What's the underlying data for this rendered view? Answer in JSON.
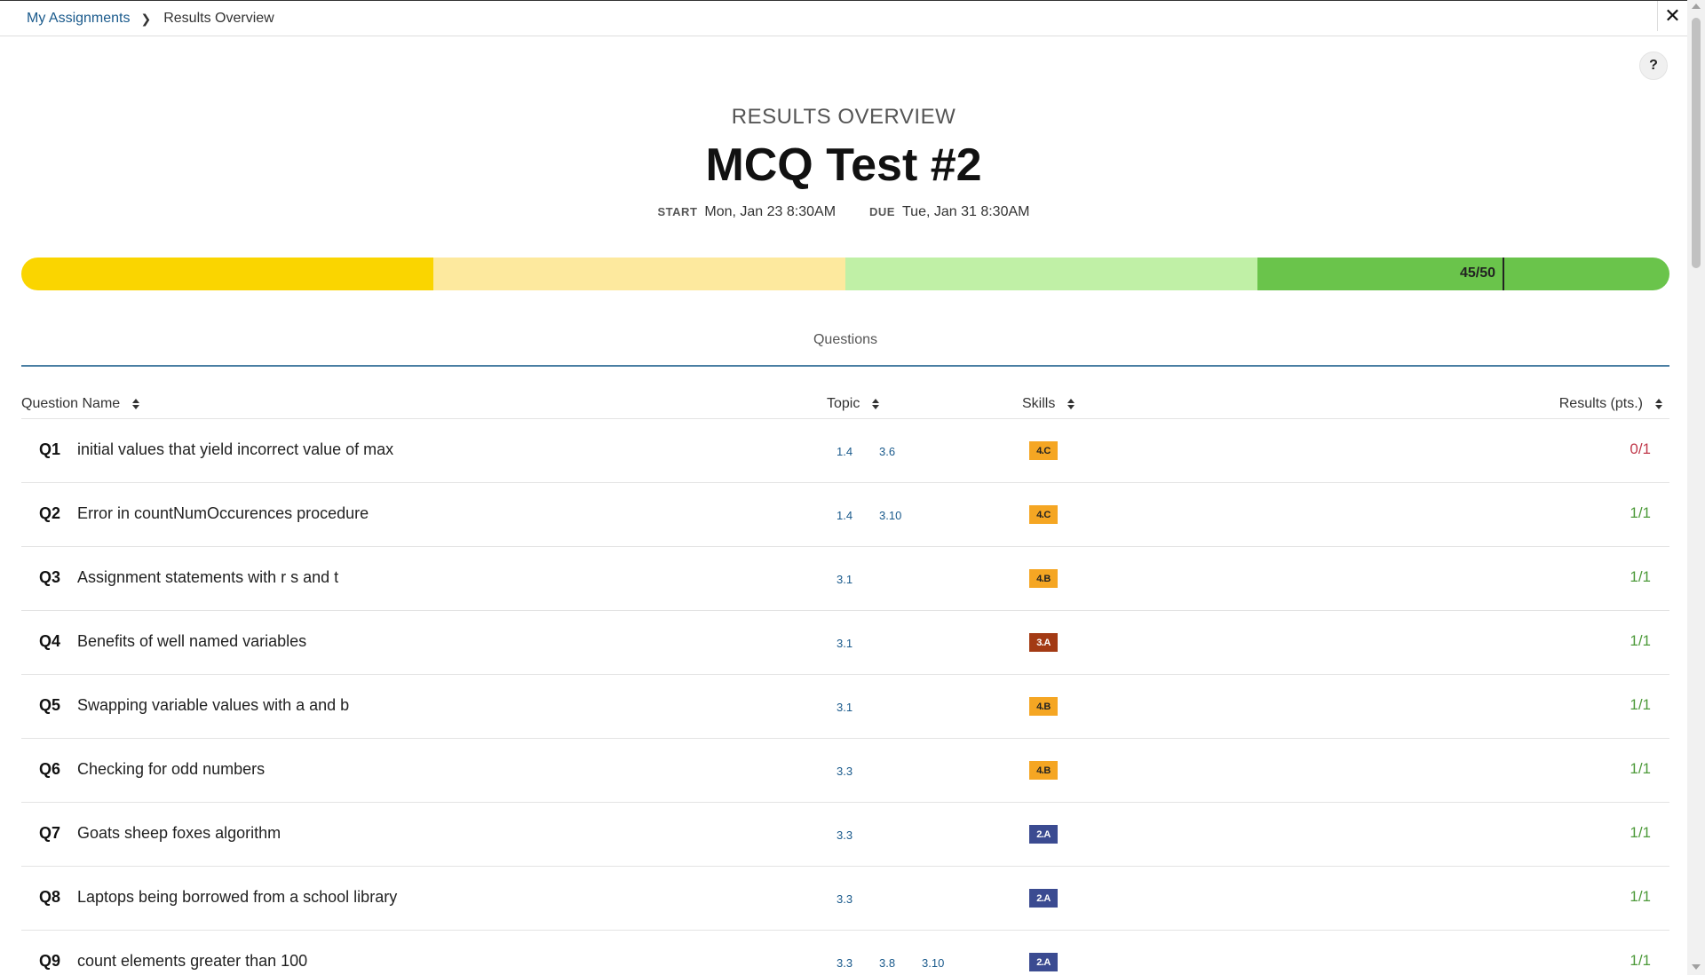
{
  "breadcrumb": {
    "parent": "My Assignments",
    "current": "Results Overview"
  },
  "icons": {
    "close": "close-icon",
    "help": "help-icon",
    "chevron": "chevron-right-icon",
    "sort": "sort-icon"
  },
  "close_glyph": "✕",
  "help_glyph": "?",
  "header": {
    "eyebrow": "RESULTS OVERVIEW",
    "title": "MCQ Test #2",
    "start_label": "START",
    "start_value": "Mon, Jan 23 8:30AM",
    "due_label": "DUE",
    "due_value": "Tue, Jan 31 8:30AM"
  },
  "score": {
    "label": "45/50",
    "earned": 45,
    "total": 50,
    "segment_colors": [
      "#fad500",
      "#fde99e",
      "#c0f0a6",
      "#6ac44b"
    ]
  },
  "tabs": {
    "questions": "Questions"
  },
  "columns": {
    "name": "Question Name",
    "topic": "Topic",
    "skills": "Skills",
    "results": "Results (pts.)"
  },
  "colors": {
    "skill_orange": "#f5a623",
    "skill_brown": "#a33a14",
    "skill_navy": "#3b4b91",
    "result_correct": "#4d9a3a",
    "result_incorrect": "#c0394b",
    "link": "#1a5a8c"
  },
  "questions": [
    {
      "num": "Q1",
      "name": "initial values that yield incorrect value of max",
      "topics": [
        "1.4",
        "3.6"
      ],
      "skill": "4.C",
      "skill_color": "#f5a623",
      "skill_text": "#222",
      "result": "0/1",
      "correct": false
    },
    {
      "num": "Q2",
      "name": "Error in countNumOccurences procedure",
      "topics": [
        "1.4",
        "3.10"
      ],
      "skill": "4.C",
      "skill_color": "#f5a623",
      "skill_text": "#222",
      "result": "1/1",
      "correct": true
    },
    {
      "num": "Q3",
      "name": "Assignment statements with r s and t",
      "topics": [
        "3.1"
      ],
      "skill": "4.B",
      "skill_color": "#f5a623",
      "skill_text": "#222",
      "result": "1/1",
      "correct": true
    },
    {
      "num": "Q4",
      "name": "Benefits of well named variables",
      "topics": [
        "3.1"
      ],
      "skill": "3.A",
      "skill_color": "#a33a14",
      "skill_text": "#fff",
      "result": "1/1",
      "correct": true
    },
    {
      "num": "Q5",
      "name": "Swapping variable values with a and b",
      "topics": [
        "3.1"
      ],
      "skill": "4.B",
      "skill_color": "#f5a623",
      "skill_text": "#222",
      "result": "1/1",
      "correct": true
    },
    {
      "num": "Q6",
      "name": "Checking for odd numbers",
      "topics": [
        "3.3"
      ],
      "skill": "4.B",
      "skill_color": "#f5a623",
      "skill_text": "#222",
      "result": "1/1",
      "correct": true
    },
    {
      "num": "Q7",
      "name": "Goats sheep foxes algorithm",
      "topics": [
        "3.3"
      ],
      "skill": "2.A",
      "skill_color": "#3b4b91",
      "skill_text": "#fff",
      "result": "1/1",
      "correct": true
    },
    {
      "num": "Q8",
      "name": "Laptops being borrowed from a school library",
      "topics": [
        "3.3"
      ],
      "skill": "2.A",
      "skill_color": "#3b4b91",
      "skill_text": "#fff",
      "result": "1/1",
      "correct": true
    },
    {
      "num": "Q9",
      "name": "count elements greater than 100",
      "topics": [
        "3.3",
        "3.8",
        "3.10"
      ],
      "skill": "2.A",
      "skill_color": "#3b4b91",
      "skill_text": "#fff",
      "result": "1/1",
      "correct": true
    }
  ]
}
